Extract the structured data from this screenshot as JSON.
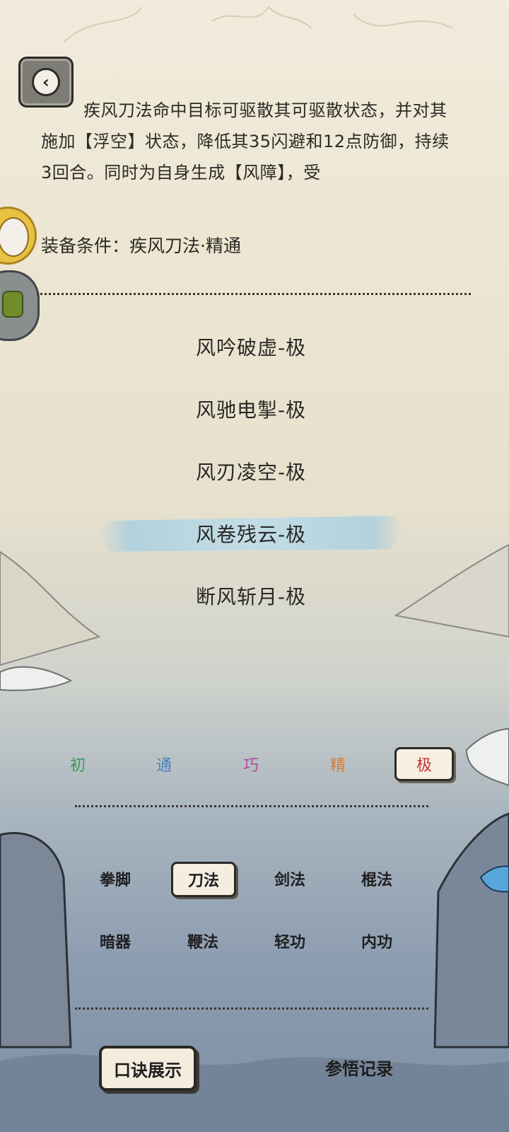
{
  "description": "疾风刀法命中目标可驱散其可驱散状态，并对其施加【浮空】状态，降低其35闪避和12点防御，持续3回合。同时为自身生成【风障】，受",
  "equip_condition": "装备条件：疾风刀法·精通",
  "moves": [
    {
      "label": "风吟破虚-极",
      "selected": false
    },
    {
      "label": "风驰电掣-极",
      "selected": false
    },
    {
      "label": "风刃凌空-极",
      "selected": false
    },
    {
      "label": "风卷残云-极",
      "selected": true
    },
    {
      "label": "断风斩月-极",
      "selected": false
    }
  ],
  "grades": [
    {
      "label": "初",
      "color": "#3c9a56",
      "selected": false
    },
    {
      "label": "通",
      "color": "#4a7fbd",
      "selected": false
    },
    {
      "label": "巧",
      "color": "#b34ba0",
      "selected": false
    },
    {
      "label": "精",
      "color": "#e07a2a",
      "selected": false
    },
    {
      "label": "极",
      "color": "#c5323a",
      "selected": true
    }
  ],
  "categories": [
    {
      "label": "拳脚",
      "selected": false
    },
    {
      "label": "刀法",
      "selected": true
    },
    {
      "label": "剑法",
      "selected": false
    },
    {
      "label": "棍法",
      "selected": false
    },
    {
      "label": "暗器",
      "selected": false
    },
    {
      "label": "鞭法",
      "selected": false
    },
    {
      "label": "轻功",
      "selected": false
    },
    {
      "label": "内功",
      "selected": false
    }
  ],
  "bottom": {
    "show_label": "口诀展示",
    "record_label": "参悟记录"
  },
  "icons": {
    "back": "chevron-left-icon",
    "avatar1": "character-avatar-icon",
    "avatar2": "character-avatar-icon"
  }
}
